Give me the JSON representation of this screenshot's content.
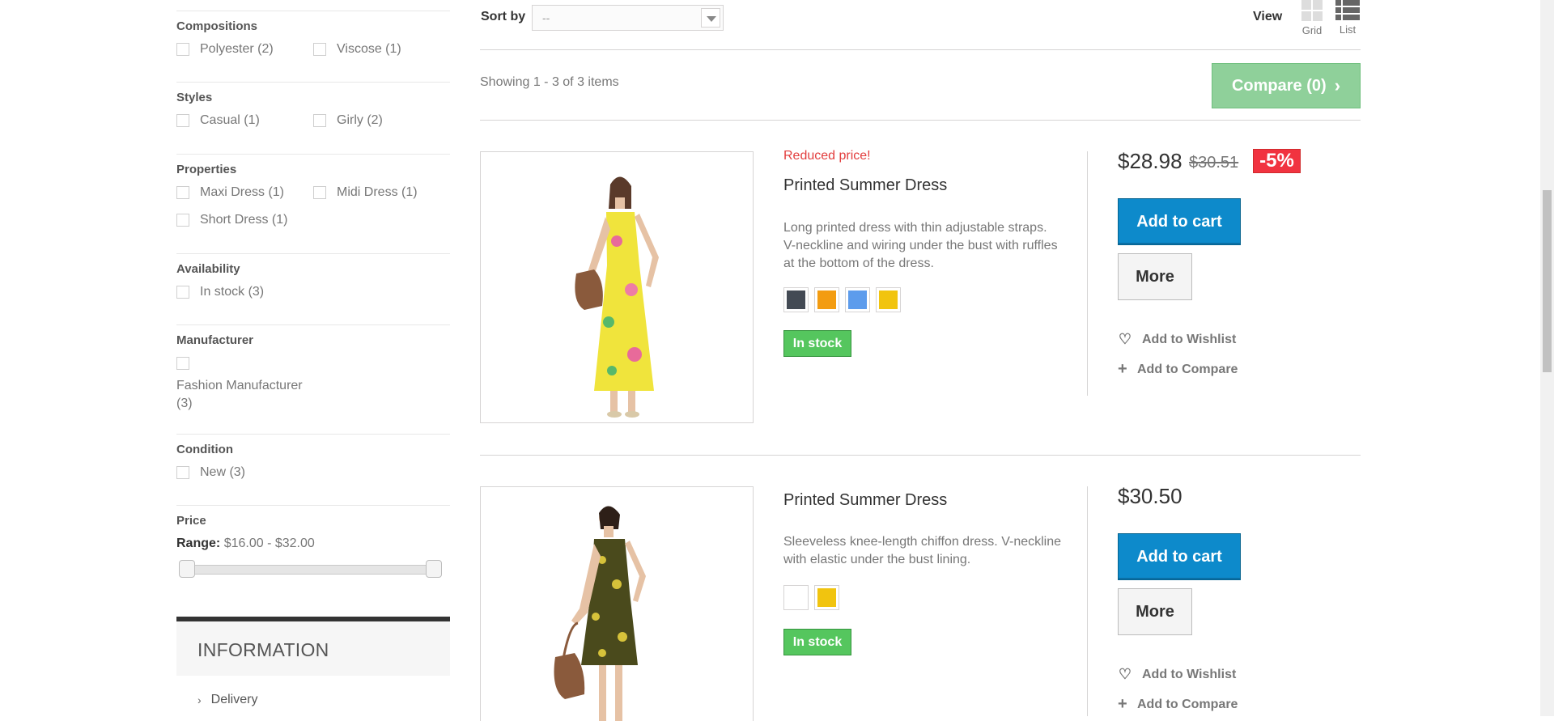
{
  "filters": {
    "compositions": {
      "title": "Compositions",
      "options": [
        "Polyester (2)",
        "Viscose (1)"
      ]
    },
    "styles": {
      "title": "Styles",
      "options": [
        "Casual (1)",
        "Girly (2)"
      ]
    },
    "properties": {
      "title": "Properties",
      "options": [
        "Maxi Dress (1)",
        "Midi Dress (1)",
        "Short Dress (1)"
      ]
    },
    "availability": {
      "title": "Availability",
      "options": [
        "In stock (3)"
      ]
    },
    "manufacturer": {
      "title": "Manufacturer",
      "options": [
        "Fashion Manufacturer",
        "(3)"
      ]
    },
    "condition": {
      "title": "Condition",
      "options": [
        "New (3)"
      ]
    },
    "price": {
      "title": "Price",
      "range_label": "Range:",
      "range_value": "$16.00 - $32.00"
    }
  },
  "information": {
    "title": "INFORMATION",
    "links": [
      "Delivery"
    ]
  },
  "toolbar": {
    "sort_label": "Sort by",
    "sort_value": "--",
    "view_label": "View",
    "grid_label": "Grid",
    "list_label": "List"
  },
  "listing": {
    "showing": "Showing 1 - 3 of 3 items",
    "compare_label": "Compare (0)"
  },
  "products": [
    {
      "reduced": "Reduced price!",
      "name": "Printed Summer Dress",
      "description": "Long printed dress with thin adjustable straps. V-neckline and wiring under the bust with ruffles at the bottom of the dress.",
      "colors": [
        "#434a54",
        "#f39c11",
        "#5d9cec",
        "#f1c40f"
      ],
      "stock": "In stock",
      "price": "$28.98",
      "old_price": "$30.51",
      "discount": "-5%",
      "cart_label": "Add to cart",
      "more_label": "More",
      "wishlist_label": "Add to Wishlist",
      "compare_label": "Add to Compare"
    },
    {
      "name": "Printed Summer Dress",
      "description": "Sleeveless knee-length chiffon dress. V-neckline with elastic under the bust lining.",
      "colors": [
        "#ffffff",
        "#f1c40f"
      ],
      "stock": "In stock",
      "price": "$30.50",
      "cart_label": "Add to cart",
      "more_label": "More",
      "wishlist_label": "Add to Wishlist",
      "compare_label": "Add to Compare"
    }
  ]
}
